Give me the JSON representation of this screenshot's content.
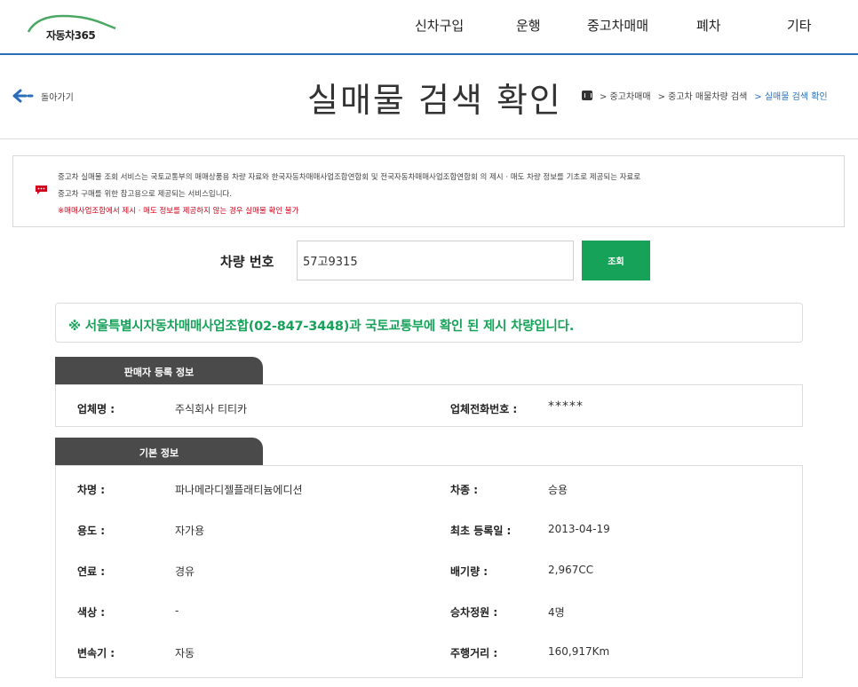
{
  "brand": {
    "logo_text": "자동차365"
  },
  "nav": {
    "items": [
      "신차구입",
      "운행",
      "중고차매매",
      "폐차",
      "기타"
    ]
  },
  "header": {
    "back_label": "돌아가기",
    "title": "실매물 검색 확인",
    "breadcrumb": [
      "> 중고차매매",
      "> 중고차 매물차량 검색",
      "> 실매물 검색 확인"
    ]
  },
  "notice": {
    "line1": "중고차 실매물 조회 서비스는 국토교통부의 매매상품용 차량 자료와 한국자동차매매사업조합연합회 및 전국자동차매매사업조합연합회 의 제시 · 매도 차량 정보를 기초로 제공되는 자료로",
    "line2": "중고차 구매를 위한 참고용으로 제공되는 서비스입니다.",
    "line3": "※매매사업조합에서 제시 · 매도 정보를 제공하지 않는 경우 실매물 확인 불가"
  },
  "search": {
    "label": "차량 번호",
    "value": "57고9315",
    "button_label": "조회"
  },
  "result": {
    "message": "※ 서울특별시자동차매매사업조합(02-847-3448)과 국토교통부에 확인 된 제시 차량입니다."
  },
  "seller": {
    "tab_label": "판매자 등록 정보",
    "company_label": "업체명 :",
    "company_value": "주식회사 티티카",
    "phone_label": "업체전화번호 :",
    "phone_value": "*****"
  },
  "basic": {
    "tab_label": "기본 정보",
    "fields": [
      {
        "label": "차명 :",
        "value": "파나메라디젤플래티늄에디션"
      },
      {
        "label": "차종 :",
        "value": "승용"
      },
      {
        "label": "용도 :",
        "value": "자가용"
      },
      {
        "label": "최초 등록일 :",
        "value": "2013-04-19"
      },
      {
        "label": "연료 :",
        "value": "경유"
      },
      {
        "label": "배기량 :",
        "value": "2,967CC"
      },
      {
        "label": "색상 :",
        "value": "-"
      },
      {
        "label": "승차정원 :",
        "value": "4명"
      },
      {
        "label": "변속기 :",
        "value": "자동"
      },
      {
        "label": "주행거리 :",
        "value": "160,917Km"
      }
    ]
  },
  "colors": {
    "accent_blue": "#2a6fba",
    "accent_green": "#17a25a",
    "warning_red": "#d0021b",
    "tab_dark": "#4a4a4a"
  }
}
